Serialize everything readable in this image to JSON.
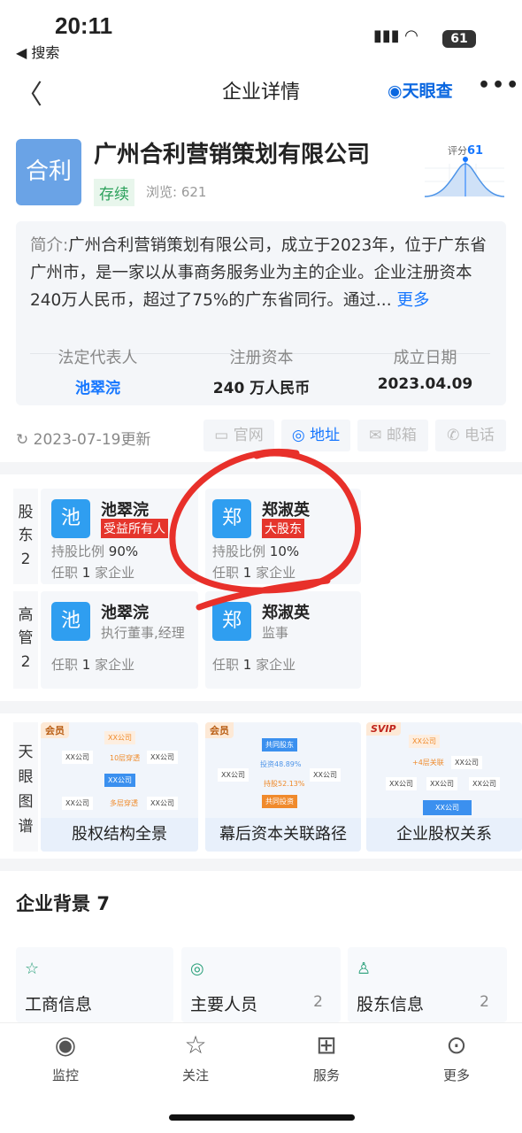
{
  "status_bar": {
    "time": "20:11",
    "back_app": "◀ 搜索",
    "battery": "61"
  },
  "nav": {
    "title": "企业详情",
    "brand": "天眼查"
  },
  "company": {
    "logo_text": "合利",
    "name": "广州合利营销策划有限公司",
    "status": "存续",
    "views": "浏览: 621",
    "score_label": "评分",
    "score": "61"
  },
  "intro": {
    "label": "简介:",
    "text": "广州合利营销策划有限公司，成立于2023年，位于广东省广州市，是一家以从事商务服务业为主的企业。企业注册资本240万人民币，超过了75%的广东省同行。通过...",
    "more": "更多"
  },
  "stats": [
    {
      "label": "法定代表人",
      "value": "池翠浣"
    },
    {
      "label": "注册资本",
      "value": "240 万人民币"
    },
    {
      "label": "成立日期",
      "value": "2023.04.09"
    }
  ],
  "update": "2023-07-19更新",
  "contact_buttons": [
    {
      "icon": "monitor-icon",
      "label": "官网"
    },
    {
      "icon": "location-icon",
      "label": "地址"
    },
    {
      "icon": "mail-icon",
      "label": "邮箱"
    },
    {
      "icon": "phone-icon",
      "label": "电话"
    }
  ],
  "shareholders": {
    "label": "股东",
    "count": "2",
    "items": [
      {
        "avatar": "池",
        "name": "池翠浣",
        "tag": "受益所有人",
        "ratio_label": "持股比例",
        "ratio": "90%",
        "job_pre": "任职",
        "job_count": "1",
        "job_suf": "家企业"
      },
      {
        "avatar": "郑",
        "name": "郑淑英",
        "tag": "大股东",
        "ratio_label": "持股比例",
        "ratio": "10%",
        "job_pre": "任职",
        "job_count": "1",
        "job_suf": "家企业"
      }
    ]
  },
  "executives": {
    "label": "高管",
    "count": "2",
    "items": [
      {
        "avatar": "池",
        "name": "池翠浣",
        "role": "执行董事,经理",
        "job_pre": "任职",
        "job_count": "1",
        "job_suf": "家企业"
      },
      {
        "avatar": "郑",
        "name": "郑淑英",
        "role": "监事",
        "job_pre": "任职",
        "job_count": "1",
        "job_suf": "家企业"
      }
    ]
  },
  "graph": {
    "label": "天眼图谱",
    "cards": [
      {
        "badge": "会员",
        "title": "股权结构全景",
        "nodes": [
          "XX公司",
          "XX公司",
          "10层穿透",
          "XX公司",
          "XX公司",
          "XX公司",
          "多层穿透",
          "XX公司"
        ]
      },
      {
        "badge": "会员",
        "title": "幕后资本关联路径",
        "nodes": [
          "共同股东",
          "XX公司",
          "投资48.89%",
          "持股52.13%",
          "XX公司",
          "共同投资"
        ]
      },
      {
        "badge": "SVIP",
        "title": "企业股权关系",
        "nodes": [
          "XX公司",
          "+4层关联",
          "XX公司",
          "XX公司",
          "XX公司",
          "XX公司",
          "XX公司"
        ]
      }
    ]
  },
  "background": {
    "title": "企业背景",
    "count": "7",
    "cards": [
      {
        "icon": "bookmark-star-icon",
        "label": "工商信息",
        "count": ""
      },
      {
        "icon": "person-icon",
        "label": "主要人员",
        "count": "2"
      },
      {
        "icon": "shareholder-icon",
        "label": "股东信息",
        "count": "2"
      }
    ]
  },
  "tabbar": [
    {
      "icon": "monitor-camera-icon",
      "label": "监控"
    },
    {
      "icon": "star-icon",
      "label": "关注"
    },
    {
      "icon": "grid-icon",
      "label": "服务"
    },
    {
      "icon": "more-circle-icon",
      "label": "更多"
    }
  ],
  "colors": {
    "accent": "#1677ff",
    "annotation": "#e8302a",
    "shareholder_tag": "#e5352c",
    "status_green": "#2aa05a"
  }
}
